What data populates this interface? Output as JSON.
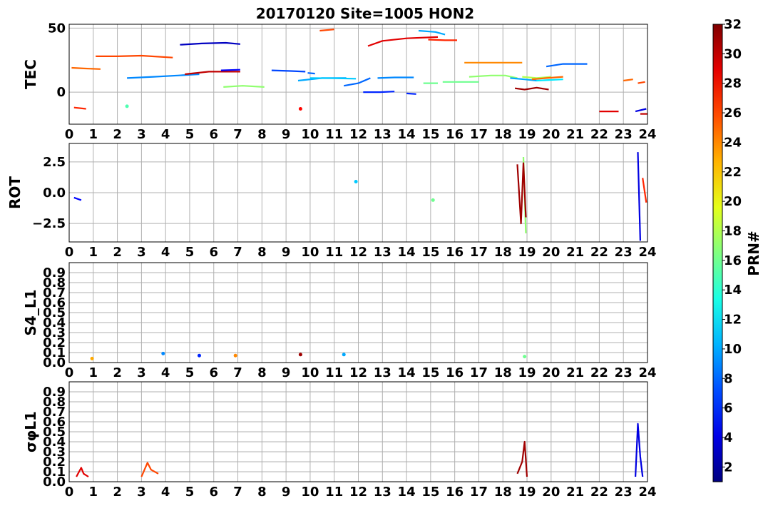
{
  "title": "20170120 Site=1005 HON2",
  "colorbar": {
    "label": "PRN#",
    "min": 1,
    "max": 32,
    "ticks": [
      "2",
      "4",
      "6",
      "8",
      "10",
      "12",
      "14",
      "16",
      "18",
      "20",
      "22",
      "24",
      "26",
      "28",
      "30",
      "32"
    ]
  },
  "chart_data": [
    {
      "type": "line",
      "ylabel": "TEC",
      "xlim": [
        0,
        24
      ],
      "ylim": [
        -25,
        53
      ],
      "xticks": [
        "0",
        "1",
        "2",
        "3",
        "4",
        "5",
        "6",
        "7",
        "8",
        "9",
        "10",
        "11",
        "12",
        "13",
        "14",
        "15",
        "16",
        "17",
        "18",
        "19",
        "20",
        "21",
        "22",
        "23",
        "24"
      ],
      "yticks": [
        "0",
        "50"
      ],
      "grid": true,
      "series": [
        {
          "prn": 25,
          "x": [
            0.1,
            0.6,
            1.3
          ],
          "y": [
            19,
            18.5,
            18
          ]
        },
        {
          "prn": 27,
          "x": [
            0.2,
            0.7
          ],
          "y": [
            -12,
            -13
          ]
        },
        {
          "prn": 15,
          "x": [
            2.4
          ],
          "y": [
            -11
          ]
        },
        {
          "prn": 26,
          "x": [
            1.1,
            2.0,
            3.0,
            4.3
          ],
          "y": [
            28,
            28,
            28.5,
            27
          ]
        },
        {
          "prn": 9,
          "x": [
            2.4,
            3.5,
            4.5,
            5.4
          ],
          "y": [
            11,
            12,
            13,
            14
          ]
        },
        {
          "prn": 3,
          "x": [
            4.6,
            5.5,
            6.5,
            7.1
          ],
          "y": [
            37,
            38,
            38.5,
            37.5
          ]
        },
        {
          "prn": 30,
          "x": [
            4.8,
            5.8,
            7.1
          ],
          "y": [
            14,
            16,
            16
          ]
        },
        {
          "prn": 5,
          "x": [
            6.3,
            7.1
          ],
          "y": [
            17,
            17.5
          ]
        },
        {
          "prn": 17,
          "x": [
            6.4,
            7.2,
            8.1
          ],
          "y": [
            4,
            5,
            4
          ]
        },
        {
          "prn": 7,
          "x": [
            8.4,
            9.2,
            9.8
          ],
          "y": [
            17,
            16.5,
            16
          ]
        },
        {
          "prn": 28,
          "x": [
            9.6
          ],
          "y": [
            -13
          ]
        },
        {
          "prn": 8,
          "x": [
            9.9,
            10.2
          ],
          "y": [
            15,
            14.5
          ]
        },
        {
          "prn": 26,
          "x": [
            10.4,
            11.0
          ],
          "y": [
            48,
            49
          ]
        },
        {
          "prn": 10,
          "x": [
            9.5,
            10.5,
            11.5
          ],
          "y": [
            9,
            11,
            11
          ]
        },
        {
          "prn": 11,
          "x": [
            10.0,
            11.0,
            11.9
          ],
          "y": [
            11,
            10.8,
            10.5
          ]
        },
        {
          "prn": 8,
          "x": [
            11.4,
            12.0,
            12.5
          ],
          "y": [
            5,
            7,
            11
          ]
        },
        {
          "prn": 29,
          "x": [
            12.4,
            13.0,
            14.0,
            15.3
          ],
          "y": [
            36,
            40,
            42,
            43
          ]
        },
        {
          "prn": 6,
          "x": [
            12.2,
            12.9,
            13.5
          ],
          "y": [
            0,
            0,
            0.5
          ]
        },
        {
          "prn": 9,
          "x": [
            12.8,
            13.5,
            14.3
          ],
          "y": [
            11,
            11.5,
            11.5
          ]
        },
        {
          "prn": 6,
          "x": [
            14.0,
            14.4
          ],
          "y": [
            -1,
            -1.5
          ]
        },
        {
          "prn": 27,
          "x": [
            14.9,
            15.6,
            16.1
          ],
          "y": [
            41,
            40.5,
            40.5
          ]
        },
        {
          "prn": 10,
          "x": [
            14.5,
            15.2,
            15.6
          ],
          "y": [
            48,
            47,
            45
          ]
        },
        {
          "prn": 16,
          "x": [
            14.7,
            15.3
          ],
          "y": [
            7,
            7
          ]
        },
        {
          "prn": 16,
          "x": [
            15.5,
            16.3,
            17.0
          ],
          "y": [
            8,
            8,
            8
          ]
        },
        {
          "prn": 24,
          "x": [
            16.4,
            17.5,
            18.8
          ],
          "y": [
            23,
            23,
            23
          ]
        },
        {
          "prn": 17,
          "x": [
            16.6,
            17.5,
            18.1,
            18.6
          ],
          "y": [
            12,
            13,
            13,
            11
          ]
        },
        {
          "prn": 10,
          "x": [
            18.3,
            18.9,
            19.4
          ],
          "y": [
            11,
            10,
            9
          ]
        },
        {
          "prn": 31,
          "x": [
            18.5,
            18.9,
            19.4,
            19.9
          ],
          "y": [
            3,
            2,
            3.5,
            2
          ]
        },
        {
          "prn": 18,
          "x": [
            18.8,
            19.4,
            20.0
          ],
          "y": [
            12,
            11,
            12
          ]
        },
        {
          "prn": 25,
          "x": [
            19.2,
            19.8,
            20.5
          ],
          "y": [
            10,
            11,
            12
          ]
        },
        {
          "prn": 12,
          "x": [
            19.4,
            19.9,
            20.5
          ],
          "y": [
            9,
            9.5,
            10
          ]
        },
        {
          "prn": 8,
          "x": [
            19.8,
            20.5,
            21.5
          ],
          "y": [
            20,
            22,
            22
          ]
        },
        {
          "prn": 29,
          "x": [
            22.0,
            22.8
          ],
          "y": [
            -15,
            -15
          ]
        },
        {
          "prn": 25,
          "x": [
            23.0,
            23.4
          ],
          "y": [
            9,
            10
          ]
        },
        {
          "prn": 26,
          "x": [
            23.6,
            23.9
          ],
          "y": [
            7,
            8
          ]
        },
        {
          "prn": 4,
          "x": [
            23.5,
            23.95
          ],
          "y": [
            -15,
            -13
          ]
        },
        {
          "prn": 30,
          "x": [
            23.7,
            24.0
          ],
          "y": [
            -17,
            -17
          ]
        }
      ]
    },
    {
      "type": "line",
      "ylabel": "ROT",
      "xlim": [
        0,
        24
      ],
      "ylim": [
        -4,
        4
      ],
      "xticks": [
        "0",
        "1",
        "2",
        "3",
        "4",
        "5",
        "6",
        "7",
        "8",
        "9",
        "10",
        "11",
        "12",
        "13",
        "14",
        "15",
        "16",
        "17",
        "18",
        "19",
        "20",
        "21",
        "22",
        "23",
        "24"
      ],
      "yticks": [
        "2.5",
        "0.0",
        "−2.5"
      ],
      "grid": true,
      "series": [
        {
          "prn": 5,
          "x": [
            0.2,
            0.5
          ],
          "y": [
            -0.4,
            -0.6
          ]
        },
        {
          "prn": 11,
          "x": [
            11.9
          ],
          "y": [
            0.9
          ]
        },
        {
          "prn": 16,
          "x": [
            15.1
          ],
          "y": [
            -0.6
          ]
        },
        {
          "prn": 17,
          "x": [
            18.85,
            18.95
          ],
          "y": [
            2.9,
            -3.3
          ]
        },
        {
          "prn": 31,
          "x": [
            18.6,
            18.75,
            18.85,
            18.95
          ],
          "y": [
            2.3,
            -2.5,
            2.4,
            -2.0
          ]
        },
        {
          "prn": 4,
          "x": [
            23.6,
            23.7
          ],
          "y": [
            3.3,
            -3.9
          ]
        },
        {
          "prn": 27,
          "x": [
            23.8,
            23.95
          ],
          "y": [
            1.2,
            -0.8
          ]
        }
      ]
    },
    {
      "type": "line",
      "ylabel": "S4_L1",
      "xlim": [
        0,
        24
      ],
      "ylim": [
        0,
        1
      ],
      "xticks": [
        "0",
        "1",
        "2",
        "3",
        "4",
        "5",
        "6",
        "7",
        "8",
        "9",
        "10",
        "11",
        "12",
        "13",
        "14",
        "15",
        "16",
        "17",
        "18",
        "19",
        "20",
        "21",
        "22",
        "23",
        "24"
      ],
      "yticks": [
        "0.0",
        "0.1",
        "0.2",
        "0.3",
        "0.4",
        "0.5",
        "0.6",
        "0.7",
        "0.8",
        "0.9"
      ],
      "grid": true,
      "series": [
        {
          "prn": 23,
          "x": [
            0.95
          ],
          "y": [
            0.04
          ]
        },
        {
          "prn": 9,
          "x": [
            3.9
          ],
          "y": [
            0.09
          ]
        },
        {
          "prn": 6,
          "x": [
            5.4
          ],
          "y": [
            0.07
          ]
        },
        {
          "prn": 24,
          "x": [
            6.9
          ],
          "y": [
            0.07
          ]
        },
        {
          "prn": 31,
          "x": [
            9.6
          ],
          "y": [
            0.08
          ]
        },
        {
          "prn": 10,
          "x": [
            11.4
          ],
          "y": [
            0.08
          ]
        },
        {
          "prn": 16,
          "x": [
            18.9
          ],
          "y": [
            0.06
          ]
        }
      ]
    },
    {
      "type": "line",
      "ylabel": "σφL1",
      "xlim": [
        0,
        24
      ],
      "ylim": [
        0,
        1
      ],
      "xticks": [
        "0",
        "1",
        "2",
        "3",
        "4",
        "5",
        "6",
        "7",
        "8",
        "9",
        "10",
        "11",
        "12",
        "13",
        "14",
        "15",
        "16",
        "17",
        "18",
        "19",
        "20",
        "21",
        "22",
        "23",
        "24"
      ],
      "yticks": [
        "0.0",
        "0.1",
        "0.2",
        "0.3",
        "0.4",
        "0.5",
        "0.6",
        "0.7",
        "0.8",
        "0.9"
      ],
      "grid": true,
      "series": [
        {
          "prn": 29,
          "x": [
            0.3,
            0.5,
            0.6,
            0.8
          ],
          "y": [
            0.05,
            0.14,
            0.08,
            0.05
          ]
        },
        {
          "prn": 26,
          "x": [
            3.0,
            3.25,
            3.4,
            3.7
          ],
          "y": [
            0.05,
            0.19,
            0.12,
            0.08
          ]
        },
        {
          "prn": 31,
          "x": [
            18.6,
            18.8,
            18.9,
            19.0
          ],
          "y": [
            0.08,
            0.2,
            0.4,
            0.05
          ]
        },
        {
          "prn": 4,
          "x": [
            23.5,
            23.6,
            23.7,
            23.8
          ],
          "y": [
            0.05,
            0.58,
            0.25,
            0.05
          ]
        }
      ]
    }
  ]
}
